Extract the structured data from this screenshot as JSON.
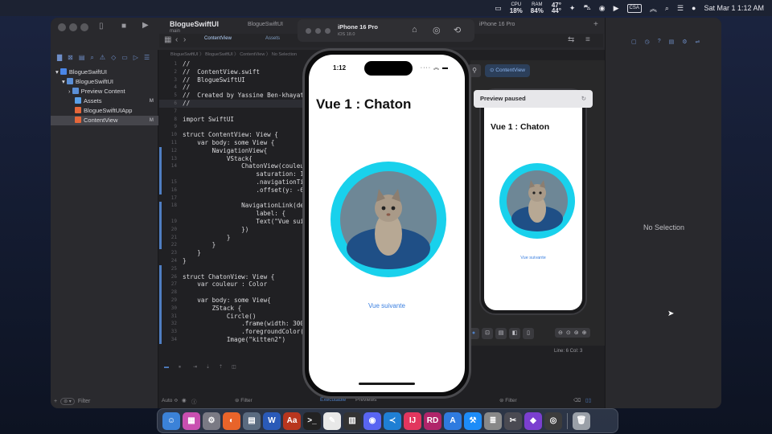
{
  "menubar": {
    "apple": "",
    "cpu_label": "CPU",
    "cpu_value": "18%",
    "ram_label": "RAM",
    "ram_value": "84%",
    "temp_value": "47°",
    "temp_value2": "44°",
    "csa": "CSA",
    "datetime": "Sat Mar 1  1:12 AM"
  },
  "xcode": {
    "project": "BlogueSwiftUI",
    "branch": "main",
    "tabs": [
      "ContentView",
      "Assets"
    ],
    "tab_right": "iPhone 16 Pro"
  },
  "navigator": {
    "items": [
      {
        "label": "BlogueSwiftUI",
        "badge": ""
      },
      {
        "label": "BlogueSwiftUI",
        "badge": ""
      },
      {
        "label": "Preview Content",
        "badge": ""
      },
      {
        "label": "Assets",
        "badge": "M"
      },
      {
        "label": "BlogueSwiftUIApp",
        "badge": ""
      },
      {
        "label": "ContentView",
        "badge": "M"
      }
    ],
    "filter": "Filter"
  },
  "editor": {
    "crumbs": "BlogueSwiftUI 〉 BlogueSwiftUI 〉 ContentView 〉 No Selection",
    "lines": [
      {
        "n": "1",
        "t": "//"
      },
      {
        "n": "2",
        "t": "//  ContentView.swift"
      },
      {
        "n": "3",
        "t": "//  BlogueSwiftUI"
      },
      {
        "n": "4",
        "t": "//"
      },
      {
        "n": "5",
        "t": "//  Created by Yassine Ben-khayat"
      },
      {
        "n": "6",
        "t": "//"
      },
      {
        "n": "7",
        "t": ""
      },
      {
        "n": "8",
        "t": "import SwiftUI"
      },
      {
        "n": "9",
        "t": ""
      },
      {
        "n": "10",
        "t": "struct ContentView: View {"
      },
      {
        "n": "11",
        "t": "    var body: some View {"
      },
      {
        "n": "12",
        "t": "        NavigationView{"
      },
      {
        "n": "13",
        "t": "            VStack{"
      },
      {
        "n": "14",
        "t": "                ChatonView(couleur"
      },
      {
        "n": "",
        "t": "                    saturation: 1"
      },
      {
        "n": "15",
        "t": "                    .navigationTi"
      },
      {
        "n": "16",
        "t": "                    .offset(y: -6"
      },
      {
        "n": "17",
        "t": ""
      },
      {
        "n": "18",
        "t": "                NavigationLink(des"
      },
      {
        "n": "",
        "t": "                    label: {"
      },
      {
        "n": "19",
        "t": "                    Text(\"Vue suiv"
      },
      {
        "n": "20",
        "t": "                })"
      },
      {
        "n": "21",
        "t": "            }"
      },
      {
        "n": "22",
        "t": "        }"
      },
      {
        "n": "23",
        "t": "    }"
      },
      {
        "n": "24",
        "t": "}"
      },
      {
        "n": "25",
        "t": ""
      },
      {
        "n": "26",
        "t": "struct ChatonView: View {"
      },
      {
        "n": "27",
        "t": "    var couleur : Color"
      },
      {
        "n": "28",
        "t": ""
      },
      {
        "n": "29",
        "t": "    var body: some View{"
      },
      {
        "n": "30",
        "t": "        ZStack {"
      },
      {
        "n": "31",
        "t": "            Circle()"
      },
      {
        "n": "32",
        "t": "                .frame(width: 300,"
      },
      {
        "n": "33",
        "t": "                .foregroundColor(c"
      },
      {
        "n": "34",
        "t": "            Image(\"kitten2\")"
      }
    ],
    "bottom_auto": "Auto ≎",
    "bottom_filter": "Filter",
    "preview_filter": "Filter",
    "preview_tabs": [
      "Executable",
      "Previews"
    ]
  },
  "preview": {
    "chip": "ContentView",
    "paused": "Preview paused",
    "title": "Vue 1 : Chaton",
    "link": "Vue suivante",
    "line_col": "Line: 6  Col: 3"
  },
  "inspector": {
    "no_selection": "No Selection"
  },
  "simulator": {
    "device": "iPhone 16 Pro",
    "os": "iOS 18.0",
    "time": "1:12",
    "title": "Vue 1 : Chaton",
    "link": "Vue suivante"
  },
  "colors": {
    "ring": "#19d1ec",
    "link": "#3a7fe0"
  },
  "dock": {
    "apps": [
      "Finder",
      "Launchpad",
      "System Settings",
      "Firefox",
      "Preview",
      "Word",
      "Dictionary",
      "Terminal",
      "TextEdit",
      "Activity Monitor",
      "Discord",
      "VS Code",
      "IntelliJ",
      "Rider",
      "Xcode Instruments",
      "Xcode",
      "Database",
      "Screenshot",
      "Photo Editor",
      "OBS",
      "Trash"
    ]
  }
}
